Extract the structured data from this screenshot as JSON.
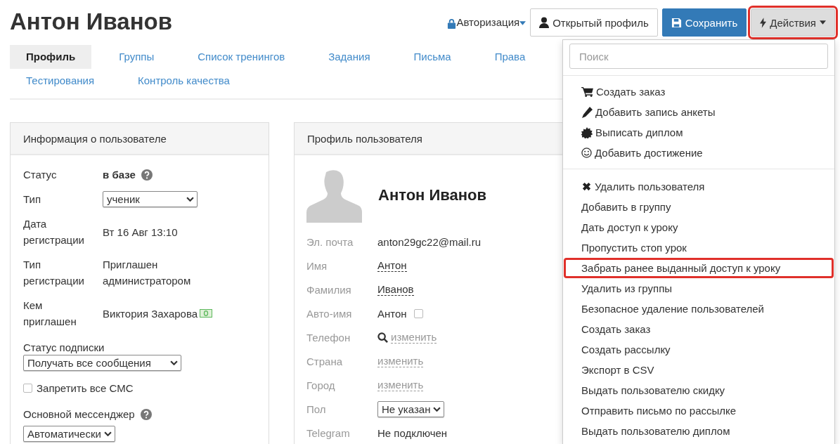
{
  "header": {
    "title": "Антон Иванов",
    "auth_link": "Авторизация",
    "buttons": [
      {
        "label": "Открытый профиль",
        "kind": "profile",
        "highlighted": false
      },
      {
        "label": "Сохранить",
        "kind": "save",
        "highlighted": false
      },
      {
        "label": "Действия",
        "kind": "actions",
        "highlighted": true
      }
    ]
  },
  "tabs": [
    {
      "label": "Профиль",
      "selected": true
    },
    {
      "label": "Группы",
      "selected": false
    },
    {
      "label": "Список тренингов",
      "selected": false
    },
    {
      "label": "Задания",
      "selected": false
    },
    {
      "label": "Письма",
      "selected": false
    },
    {
      "label": "Права",
      "selected": false
    },
    {
      "label": "Тестирования",
      "selected": false
    },
    {
      "label": "Контроль качества",
      "selected": false
    }
  ],
  "user_info": {
    "title": "Информация о пользователе",
    "rows": [
      {
        "label": "Статус",
        "value": "в базе",
        "kind": "status"
      },
      {
        "label": "Тип",
        "value": "ученик",
        "kind": "select"
      },
      {
        "label": "Дата регистрации",
        "value": "Вт 16 Авг 13:10",
        "kind": "text"
      },
      {
        "label": "Тип регистрации",
        "value": "Приглашен администратором",
        "kind": "text"
      },
      {
        "label": "Кем приглашен",
        "value": "Виктория Захарова",
        "kind": "money"
      }
    ],
    "subscription": {
      "label": "Статус подписки",
      "value": "Получать все сообщения"
    },
    "sms": {
      "label": "Запретить все СМС",
      "checked": false
    },
    "messenger": {
      "label": "Основной мессенджер",
      "value": "Автоматически"
    }
  },
  "profile": {
    "title": "Профиль пользователя",
    "name": "Антон Иванов",
    "rows": [
      {
        "label": "Эл. почта",
        "value": "anton29gc22@mail.ru",
        "kind": "text"
      },
      {
        "label": "Имя",
        "value": "Антон",
        "kind": "editable"
      },
      {
        "label": "Фамилия",
        "value": "Иванов",
        "kind": "editable"
      },
      {
        "label": "Авто-имя",
        "value": "Антон",
        "kind": "checkbox",
        "checked": false
      },
      {
        "label": "Телефон",
        "value": "изменить",
        "kind": "phone"
      },
      {
        "label": "Страна",
        "value": "изменить",
        "kind": "link"
      },
      {
        "label": "Город",
        "value": "изменить",
        "kind": "link"
      },
      {
        "label": "Пол",
        "value": "Не указан",
        "kind": "select"
      },
      {
        "label": "Telegram",
        "value": "Не подключен",
        "kind": "text"
      }
    ]
  },
  "actions_menu": {
    "search": {
      "placeholder": "Поиск"
    },
    "groups": [
      [
        {
          "label": "Создать заказ",
          "kind": "cart",
          "highlighted": false
        },
        {
          "label": "Добавить запись анкеты",
          "kind": "pencil",
          "highlighted": false
        },
        {
          "label": "Выписать диплом",
          "kind": "seal",
          "highlighted": false
        },
        {
          "label": "Добавить достижение",
          "kind": "smiley",
          "highlighted": false
        }
      ],
      [
        {
          "label": "Удалить пользователя",
          "kind": "cross",
          "highlighted": false
        },
        {
          "label": "Добавить в группу",
          "kind": "plain",
          "highlighted": false
        },
        {
          "label": "Дать доступ к уроку",
          "kind": "plain",
          "highlighted": false
        },
        {
          "label": "Пропустить стоп урок",
          "kind": "plain",
          "highlighted": false
        },
        {
          "label": "Забрать ранее выданный доступ к уроку",
          "kind": "plain",
          "highlighted": true
        },
        {
          "label": "Удалить из группы",
          "kind": "plain",
          "highlighted": false
        },
        {
          "label": "Безопасное удаление пользователей",
          "kind": "plain",
          "highlighted": false
        },
        {
          "label": "Создать заказ",
          "kind": "plain",
          "highlighted": false
        },
        {
          "label": "Создать рассылку",
          "kind": "plain",
          "highlighted": false
        },
        {
          "label": "Экспорт в CSV",
          "kind": "plain",
          "highlighted": false
        },
        {
          "label": "Выдать пользователю скидку",
          "kind": "plain",
          "highlighted": false
        },
        {
          "label": "Отправить письмо по рассылке",
          "kind": "plain",
          "highlighted": false
        },
        {
          "label": "Выдать пользователю диплом",
          "kind": "plain",
          "highlighted": false
        }
      ]
    ]
  }
}
